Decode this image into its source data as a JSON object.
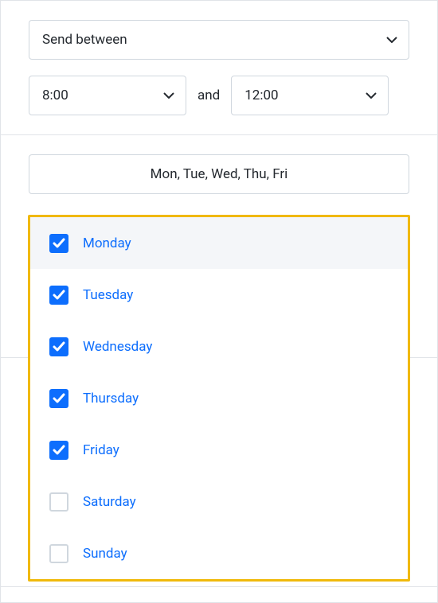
{
  "schedule": {
    "mode_label": "Send between",
    "start_time": "8:00",
    "end_time": "12:00",
    "and_text": "and"
  },
  "days": {
    "summary": "Mon, Tue, Wed, Thu, Fri",
    "items": [
      {
        "label": "Monday",
        "checked": true,
        "highlighted": true
      },
      {
        "label": "Tuesday",
        "checked": true,
        "highlighted": false
      },
      {
        "label": "Wednesday",
        "checked": true,
        "highlighted": false
      },
      {
        "label": "Thursday",
        "checked": true,
        "highlighted": false
      },
      {
        "label": "Friday",
        "checked": true,
        "highlighted": false
      },
      {
        "label": "Saturday",
        "checked": false,
        "highlighted": false
      },
      {
        "label": "Sunday",
        "checked": false,
        "highlighted": false
      }
    ]
  },
  "colors": {
    "accent": "#0d6efd",
    "highlight_border": "#f0b90b",
    "border": "#d0d7de"
  }
}
